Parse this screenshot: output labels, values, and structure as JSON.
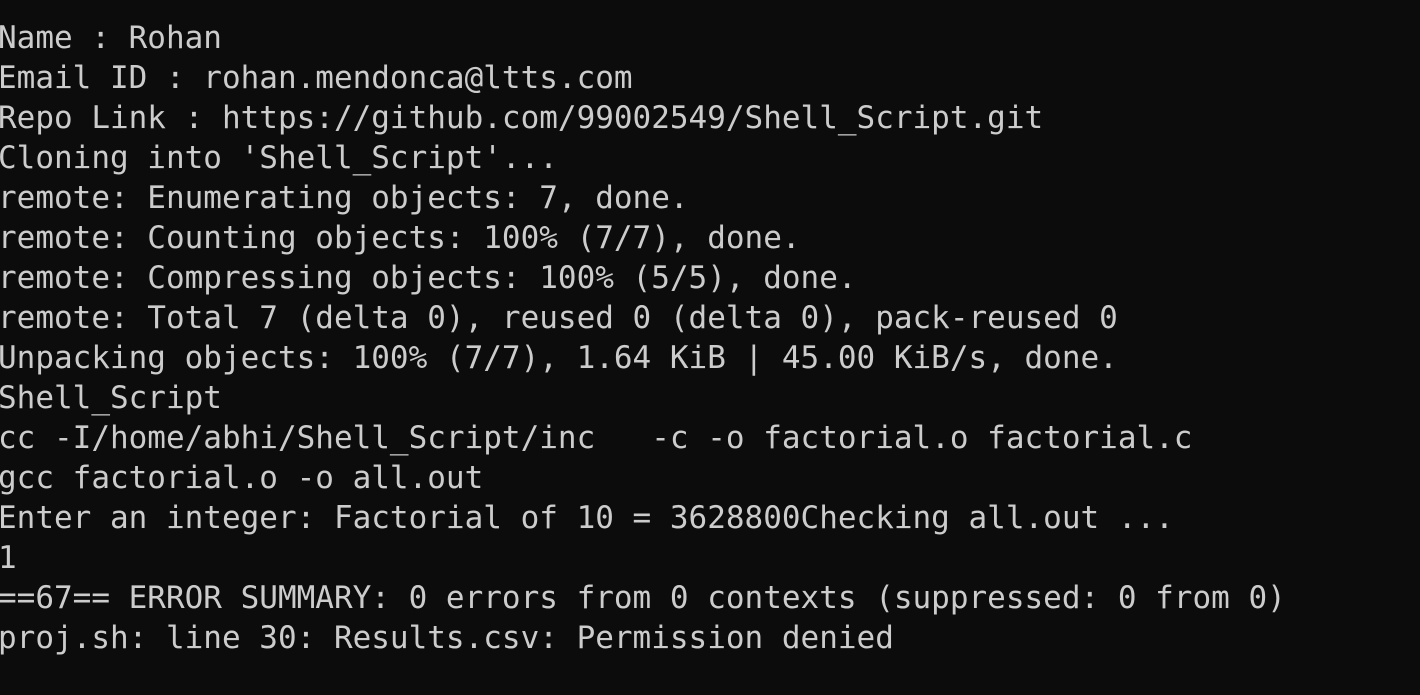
{
  "terminal": {
    "lines": [
      "Name : Rohan",
      "Email ID : rohan.mendonca@ltts.com",
      "Repo Link : https://github.com/99002549/Shell_Script.git",
      "Cloning into 'Shell_Script'...",
      "remote: Enumerating objects: 7, done.",
      "remote: Counting objects: 100% (7/7), done.",
      "remote: Compressing objects: 100% (5/5), done.",
      "remote: Total 7 (delta 0), reused 0 (delta 0), pack-reused 0",
      "Unpacking objects: 100% (7/7), 1.64 KiB | 45.00 KiB/s, done.",
      "Shell_Script",
      "cc -I/home/abhi/Shell_Script/inc   -c -o factorial.o factorial.c",
      "gcc factorial.o -o all.out",
      "Enter an integer: Factorial of 10 = 3628800Checking all.out ...",
      "1",
      "==67== ERROR SUMMARY: 0 errors from 0 contexts (suppressed: 0 from 0)",
      "proj.sh: line 30: Results.csv: Permission denied"
    ]
  },
  "colors": {
    "background": "#0c0c0c",
    "foreground": "#cccccc"
  }
}
